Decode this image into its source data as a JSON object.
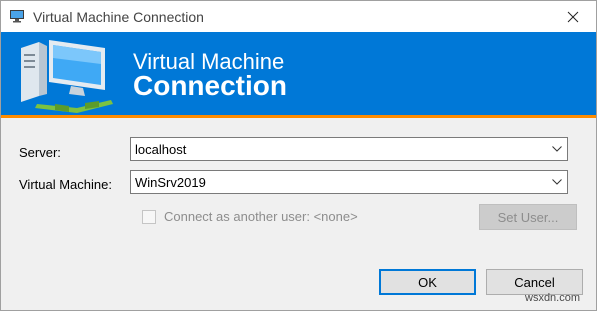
{
  "window": {
    "title": "Virtual Machine Connection",
    "icons": {
      "app": "vm-monitor-icon",
      "close": "close-icon"
    }
  },
  "banner": {
    "line1": "Virtual Machine",
    "line2": "Connection",
    "background_color": "#0078d7",
    "accent_color": "#ff8c00",
    "icon": "computer-network-illustration"
  },
  "form": {
    "server_label": "Server:",
    "server_value": "localhost",
    "vm_label": "Virtual Machine:",
    "vm_value": "WinSrv2019",
    "connect_other_label": "Connect as another user: <none>",
    "connect_other_checked": false,
    "set_user_label": "Set User..."
  },
  "footer": {
    "ok_label": "OK",
    "cancel_label": "Cancel"
  },
  "watermark": "wsxdn.com"
}
